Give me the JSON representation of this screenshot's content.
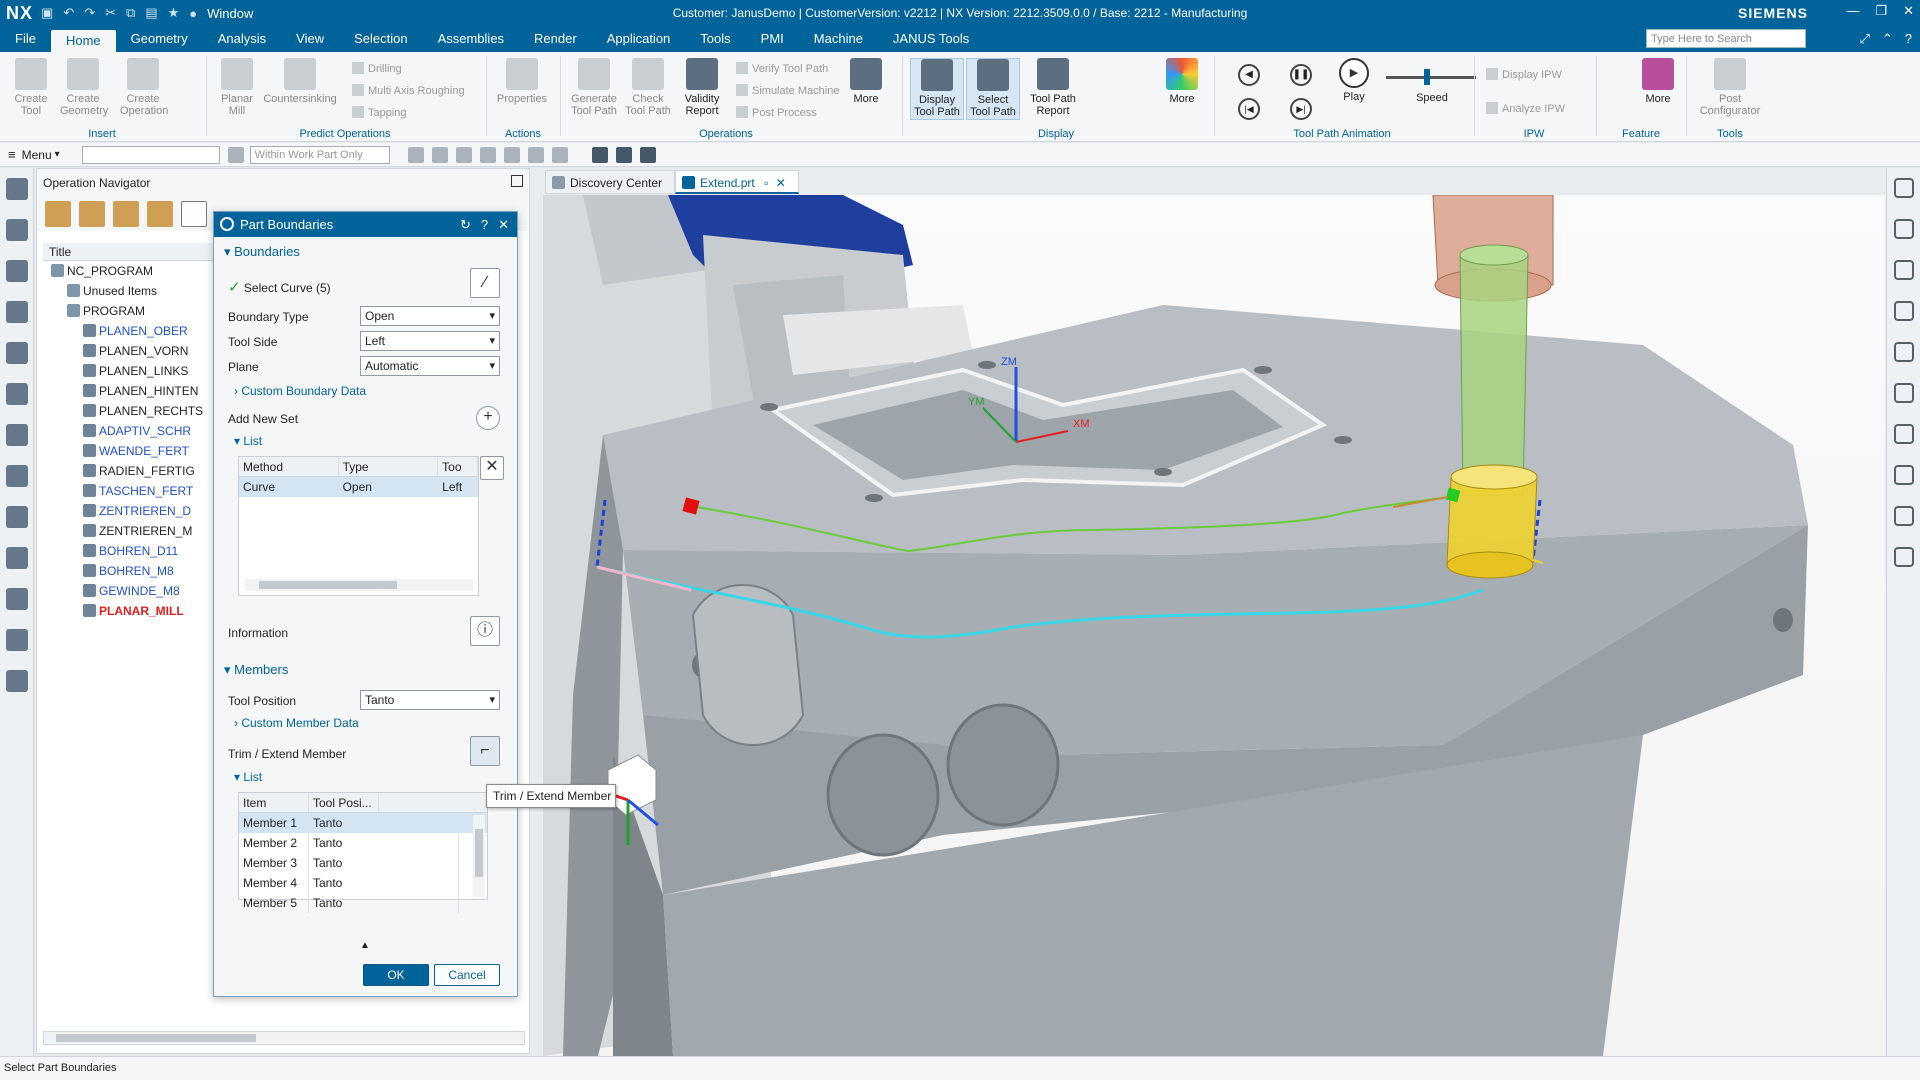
{
  "titlebar": {
    "logo": "NX",
    "window_menu": "Window",
    "title": "Customer: JanusDemo | CustomerVersion: v2212 | NX Version: 2212.3509.0.0 / Base: 2212 - Manufacturing",
    "brand": "SIEMENS"
  },
  "menu": {
    "tabs": [
      "File",
      "Home",
      "Geometry",
      "Analysis",
      "View",
      "Selection",
      "Assemblies",
      "Render",
      "Application",
      "Tools",
      "PMI",
      "Machine",
      "JANUS Tools"
    ],
    "active": "Home",
    "search_placeholder": "Type Here to Search"
  },
  "ribbon": {
    "insert": {
      "label": "Insert",
      "create_tool": "Create Tool",
      "create_geometry": "Create Geometry",
      "create_operation": "Create Operation"
    },
    "predict": {
      "label": "Predict Operations",
      "planar_mill": "Planar Mill",
      "countersinking": "Countersinking",
      "drilling": "Drilling",
      "multi_axis": "Multi Axis Roughing",
      "tapping": "Tapping"
    },
    "actions": {
      "label": "Actions",
      "properties": "Properties"
    },
    "operations": {
      "label": "Operations",
      "generate": "Generate Tool Path",
      "check": "Check Tool Path",
      "validity": "Validity Report",
      "verify": "Verify Tool Path",
      "simulate": "Simulate Machine",
      "post": "Post Process",
      "more": "More"
    },
    "display": {
      "label": "Display",
      "display_tp": "Display Tool Path",
      "select_tp": "Select Tool Path",
      "report": "Tool Path Report",
      "more": "More"
    },
    "animation": {
      "label": "Tool Path Animation",
      "play": "Play",
      "speed": "Speed"
    },
    "ipw": {
      "label": "IPW",
      "display_ipw": "Display IPW",
      "analyze_ipw": "Analyze IPW"
    },
    "feature": {
      "label": "Feature",
      "more": "More"
    },
    "tools": {
      "label": "Tools",
      "post_config": "Post Configurator"
    }
  },
  "toolbar2": {
    "menu": "Menu",
    "scope": "Within Work Part Only"
  },
  "navigator": {
    "title": "Operation Navigator",
    "column": "Title",
    "nodes": [
      {
        "label": "NC_PROGRAM",
        "indent": 0,
        "style": ""
      },
      {
        "label": "Unused Items",
        "indent": 1,
        "style": ""
      },
      {
        "label": "PROGRAM",
        "indent": 1,
        "style": ""
      },
      {
        "label": "PLANEN_OBER",
        "indent": 2,
        "style": "blue"
      },
      {
        "label": "PLANEN_VORN",
        "indent": 2,
        "style": ""
      },
      {
        "label": "PLANEN_LINKS",
        "indent": 2,
        "style": ""
      },
      {
        "label": "PLANEN_HINTEN",
        "indent": 2,
        "style": ""
      },
      {
        "label": "PLANEN_RECHTS",
        "indent": 2,
        "style": ""
      },
      {
        "label": "ADAPTIV_SCHR",
        "indent": 2,
        "style": "blue"
      },
      {
        "label": "WAENDE_FERT",
        "indent": 2,
        "style": "blue"
      },
      {
        "label": "RADIEN_FERTIG",
        "indent": 2,
        "style": ""
      },
      {
        "label": "TASCHEN_FERT",
        "indent": 2,
        "style": "blue"
      },
      {
        "label": "ZENTRIEREN_D",
        "indent": 2,
        "style": "blue"
      },
      {
        "label": "ZENTRIEREN_M",
        "indent": 2,
        "style": ""
      },
      {
        "label": "BOHREN_D11",
        "indent": 2,
        "style": "blue"
      },
      {
        "label": "BOHREN_M8",
        "indent": 2,
        "style": "blue"
      },
      {
        "label": "GEWINDE_M8",
        "indent": 2,
        "style": "blue"
      },
      {
        "label": "PLANAR_MILL",
        "indent": 2,
        "style": "red"
      }
    ]
  },
  "dialog": {
    "title": "Part Boundaries",
    "boundaries": {
      "section": "Boundaries",
      "select_curve": "Select Curve (5)",
      "boundary_type_label": "Boundary Type",
      "boundary_type": "Open",
      "tool_side_label": "Tool Side",
      "tool_side": "Left",
      "plane_label": "Plane",
      "plane": "Automatic",
      "custom": "Custom Boundary Data",
      "add_new_set": "Add New Set",
      "list": "List",
      "columns": [
        "Method",
        "Type",
        "Too"
      ],
      "rows": [
        {
          "method": "Curve",
          "type": "Open",
          "tool": "Left"
        }
      ],
      "information": "Information"
    },
    "members": {
      "section": "Members",
      "tool_position_label": "Tool Position",
      "tool_position": "Tanto",
      "custom": "Custom Member Data",
      "trim_extend": "Trim / Extend Member",
      "list": "List",
      "columns": [
        "Item",
        "Tool Posi..."
      ],
      "rows": [
        {
          "item": "Member 1",
          "pos": "Tanto"
        },
        {
          "item": "Member 2",
          "pos": "Tanto"
        },
        {
          "item": "Member 3",
          "pos": "Tanto"
        },
        {
          "item": "Member 4",
          "pos": "Tanto"
        },
        {
          "item": "Member 5",
          "pos": "Tanto"
        }
      ]
    },
    "ok": "OK",
    "cancel": "Cancel"
  },
  "tooltip": "Trim / Extend Member",
  "viewtabs": [
    "Discovery Center",
    "Extend.prt"
  ],
  "axes": {
    "zm": "ZM",
    "ym": "YM",
    "xm": "XM"
  },
  "status": "Select Part Boundaries",
  "colors": {
    "brand": "#00639a",
    "curve": "#39d6e8",
    "tool_holder": "#d9a08a",
    "tool_shank": "#a7d37f",
    "tool_flute": "#f1d12f"
  }
}
